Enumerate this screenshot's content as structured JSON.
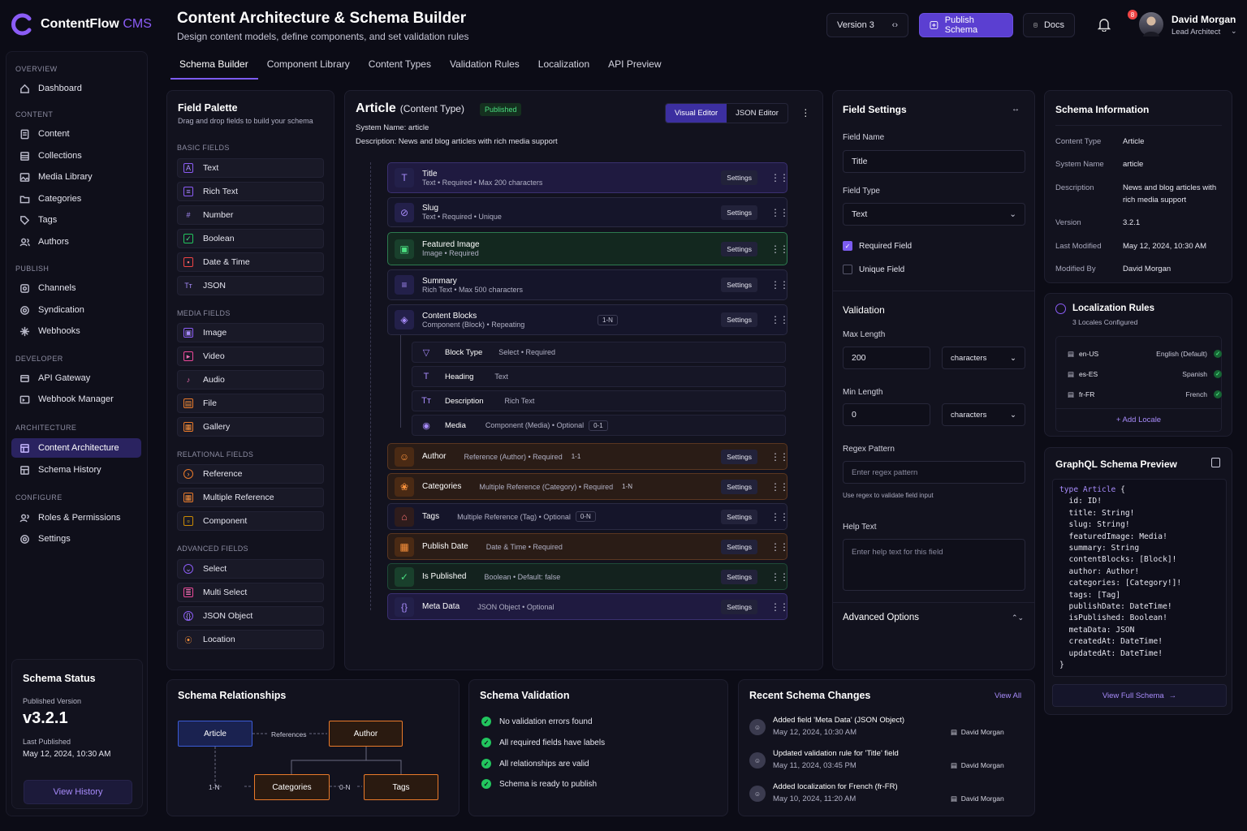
{
  "app": {
    "name": "ContentFlow",
    "suffix": "CMS"
  },
  "nav": {
    "sections": [
      {
        "title": "OVERVIEW"
      },
      {
        "title": "CONTENT"
      },
      {
        "title": "PUBLISH"
      },
      {
        "title": "DEVELOPER"
      },
      {
        "title": "ARCHITECTURE"
      },
      {
        "title": "CONFIGURE"
      }
    ],
    "items": [
      "Dashboard",
      "Content",
      "Collections",
      "Media Library",
      "Categories",
      "Tags",
      "Authors",
      "Channels",
      "Syndication",
      "Webhooks",
      "API Gateway",
      "Webhook Manager",
      "Content Architecture",
      "Schema History",
      "Roles & Permissions",
      "Settings"
    ]
  },
  "status": {
    "title": "Schema Status",
    "pub_label": "Published Version",
    "version": "v3.2.1",
    "last_label": "Last Published",
    "last_date": "May 12, 2024, 10:30 AM",
    "button": "View History"
  },
  "header": {
    "title": "Content Architecture & Schema Builder",
    "subtitle": "Design content models, define components, and set validation rules",
    "version": "Version  3",
    "publish": "Publish Schema",
    "docs": "Docs",
    "notif_count": "8",
    "user": "David Morgan",
    "role": "Lead Architect"
  },
  "tabs": [
    "Schema Builder",
    "Component Library",
    "Content Types",
    "Validation Rules",
    "Localization",
    "API Preview"
  ],
  "palette": {
    "title": "Field Palette",
    "subtitle": "Drag and drop fields to build your schema",
    "groups": [
      {
        "title": "BASIC FIELDS",
        "items": [
          "Text",
          "Rich Text",
          "Number",
          "Boolean",
          "Date & Time",
          "JSON"
        ]
      },
      {
        "title": "MEDIA FIELDS",
        "items": [
          "Image",
          "Video",
          "Audio",
          "File",
          "Gallery"
        ]
      },
      {
        "title": "RELATIONAL FIELDS",
        "items": [
          "Reference",
          "Multiple Reference",
          "Component"
        ]
      },
      {
        "title": "ADVANCED FIELDS",
        "items": [
          "Select",
          "Multi Select",
          "JSON Object",
          "Location"
        ]
      }
    ]
  },
  "canvas": {
    "name": "Article",
    "type": "(Content Type)",
    "badge": "Published",
    "system_name": "System Name:  article",
    "description": "Description: News and blog articles with rich media support",
    "toggle": [
      "Visual Editor",
      "JSON Editor"
    ],
    "settings": "Settings",
    "fields": [
      {
        "name": "Title",
        "meta": [
          "Text",
          "Required",
          "Max 200 characters"
        ]
      },
      {
        "name": "Slug",
        "meta": [
          "Text",
          "Required",
          "Unique"
        ]
      },
      {
        "name": "Featured Image",
        "meta": [
          "Image",
          "Required"
        ]
      },
      {
        "name": "Summary",
        "meta": [
          "Rich Text",
          "Max 500 characters"
        ]
      },
      {
        "name": "Content Blocks",
        "meta": [
          "Component (Block)",
          "Repeating"
        ],
        "pill": "1-N"
      },
      {
        "name": "Author",
        "meta": [
          "Reference (Author)",
          "Required"
        ],
        "pill": "1-1"
      },
      {
        "name": "Categories",
        "meta": [
          "Multiple Reference (Category)",
          "Required"
        ],
        "pill": "1-N"
      },
      {
        "name": "Tags",
        "meta": [
          "Multiple Reference (Tag)",
          "Optional"
        ],
        "pill": "0-N"
      },
      {
        "name": "Publish Date",
        "meta": [
          "Date & Time",
          "Required"
        ]
      },
      {
        "name": "Is Published",
        "meta": [
          "Boolean",
          "Default: false"
        ]
      },
      {
        "name": "Meta Data",
        "meta": [
          "JSON Object",
          "Optional"
        ]
      }
    ],
    "sub_fields": [
      {
        "name": "Block Type",
        "meta": [
          "Select",
          "Required"
        ]
      },
      {
        "name": "Heading",
        "meta": [
          "Text"
        ]
      },
      {
        "name": "Description",
        "meta": [
          "Rich Text"
        ]
      },
      {
        "name": "Media",
        "meta": [
          "Component (Media)",
          "Optional"
        ],
        "pill": "0-1"
      }
    ]
  },
  "field_settings": {
    "title": "Field Settings",
    "name_label": "Field Name",
    "name_value": "Title",
    "type_label": "Field Type",
    "type_value": "Text",
    "required": "Required Field",
    "unique": "Unique Field",
    "validation": "Validation",
    "max_label": "Max Length",
    "max_value": "200",
    "min_label": "Min Length",
    "min_value": "0",
    "unit": "characters",
    "regex_label": "Regex Pattern",
    "regex_ph": "Enter regex pattern",
    "regex_hint": "Use regex to validate field input",
    "help_label": "Help Text",
    "help_ph": "Enter help text for this field",
    "advanced": "Advanced Options"
  },
  "schema_info": {
    "title": "Schema Information",
    "rows": [
      {
        "k": "Content Type",
        "v": "Article"
      },
      {
        "k": "System Name",
        "v": "article"
      },
      {
        "k": "Description",
        "v": "News and blog articles with rich media support"
      },
      {
        "k": "Version",
        "v": "3.2.1"
      },
      {
        "k": "Last Modified",
        "v": "May 12, 2024, 10:30 AM"
      },
      {
        "k": "Modified By",
        "v": "David Morgan"
      }
    ]
  },
  "localization": {
    "title": "Localization Rules",
    "subtitle": "3 Locales Configured",
    "locales": [
      {
        "code": "en-US",
        "name": "English (Default)"
      },
      {
        "code": "es-ES",
        "name": "Spanish"
      },
      {
        "code": "fr-FR",
        "name": "French"
      }
    ],
    "add": "+ Add Locale"
  },
  "graphql": {
    "title": "GraphQL Schema Preview",
    "lines": [
      "type Article {",
      "  id: ID!",
      "  title: String!",
      "  slug: String!",
      "  featuredImage: Media!",
      "  summary: String",
      "  contentBlocks: [Block]!",
      "  author: Author!",
      "  categories: [Category!]!",
      "  tags: [Tag]",
      "  publishDate: DateTime!",
      "  isPublished: Boolean!",
      "  metaData: JSON",
      "  createdAt: DateTime!",
      "  updatedAt: DateTime!",
      "}"
    ],
    "button": "View Full Schema"
  },
  "relationships": {
    "title": "Schema Relationships",
    "nodes": [
      "Article",
      "Author",
      "Categories",
      "Tags"
    ],
    "edge_label": "References",
    "card1": "1-N",
    "card2": "0-N"
  },
  "validation": {
    "title": "Schema Validation",
    "items": [
      "No validation errors found",
      "All required fields have labels",
      "All relationships are valid",
      "Schema is ready to publish"
    ]
  },
  "changes": {
    "title": "Recent Schema Changes",
    "view_all": "View All",
    "items": [
      {
        "text": "Added field 'Meta Data' (JSON Object)",
        "date": "May 12, 2024, 10:30 AM",
        "user": "David Morgan"
      },
      {
        "text": "Updated validation rule for 'Title' field",
        "date": "May 11, 2024, 03:45 PM",
        "user": "David Morgan"
      },
      {
        "text": "Added localization for French (fr-FR)",
        "date": "May 10, 2024, 11:20 AM",
        "user": "David Morgan"
      }
    ]
  },
  "colors": {
    "accent": "#7c5cf0",
    "success": "#22c55e",
    "relation": "#fb923c",
    "background": "#0c0c16"
  }
}
